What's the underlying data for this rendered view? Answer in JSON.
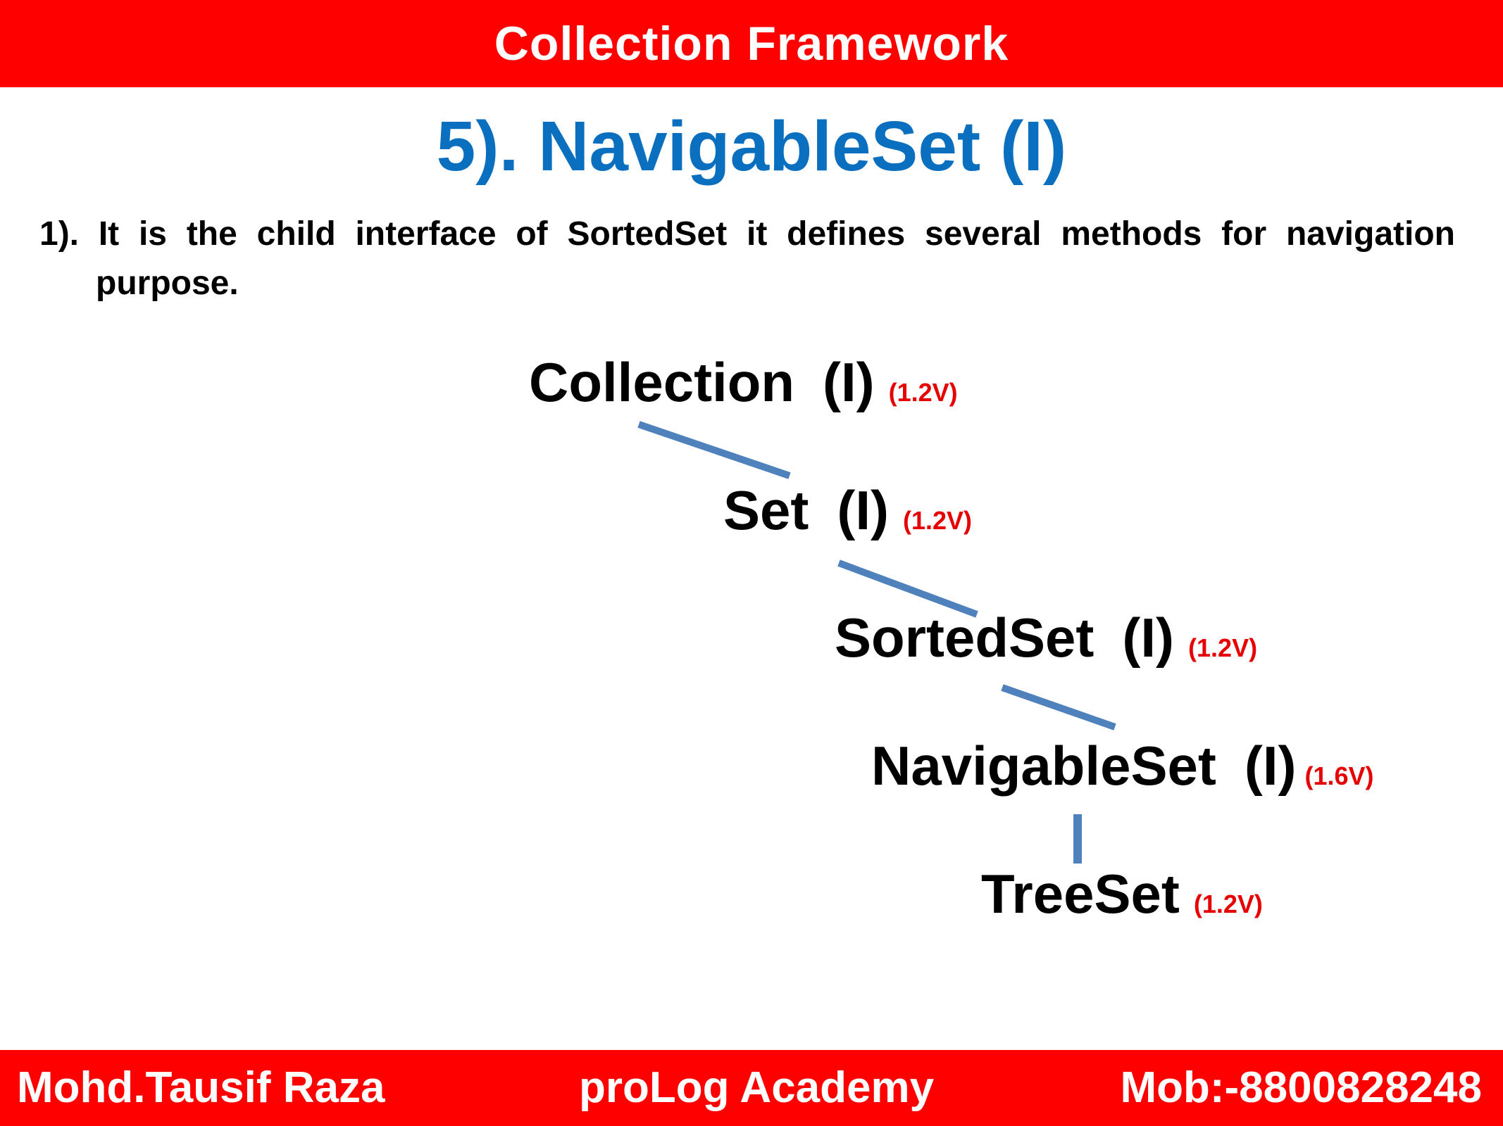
{
  "header": {
    "banner_title": "Collection Framework"
  },
  "slide": {
    "title": "5). NavigableSet  (I)",
    "point_number": "1).",
    "point_line1": [
      "It",
      "is",
      "the",
      "child",
      "interface",
      "of",
      "SortedSet",
      "it",
      "defines",
      "several",
      "methods",
      "for",
      "navigation"
    ],
    "point_line2": "purpose."
  },
  "hierarchy": [
    {
      "name": "Collection",
      "type": "(I)",
      "version": "(1.2V)"
    },
    {
      "name": "Set",
      "type": "(I)",
      "version": "(1.2V)"
    },
    {
      "name": "SortedSet",
      "type": "(I)",
      "version": "(1.2V)"
    },
    {
      "name": "NavigableSet",
      "type": "(I)",
      "version": "(1.6V)"
    },
    {
      "name": "TreeSet",
      "type": "",
      "version": "(1.2V)"
    }
  ],
  "footer": {
    "author": "Mohd.Tausif Raza",
    "academy": "proLog Academy",
    "mobile": "Mob:-8800828248"
  },
  "colors": {
    "banner": "#ff0000",
    "title": "#0b6fbf",
    "version": "#e60000",
    "connector": "#4f81bd"
  }
}
